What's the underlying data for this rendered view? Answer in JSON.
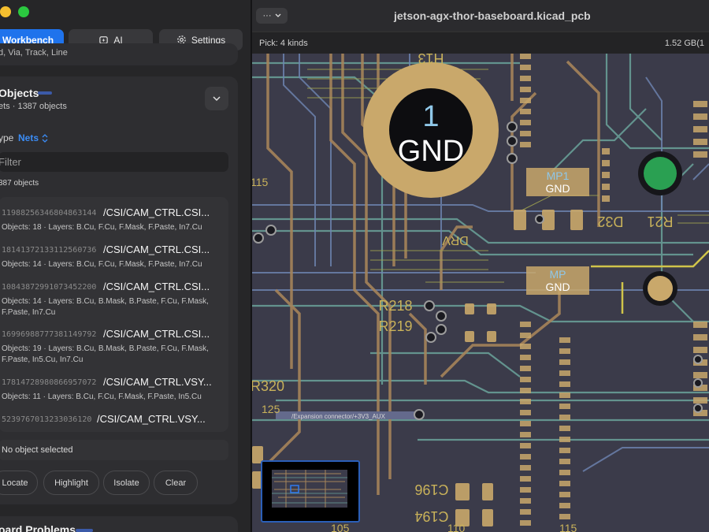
{
  "sidebar": {
    "tabs": {
      "workbench": "Workbench",
      "ai": "AI",
      "settings": "Settings"
    },
    "top_card_text": "d, Via, Track, Line",
    "objects": {
      "title": "Objects",
      "subtitle": "ets · 1387 objects",
      "type_label": "ype",
      "type_value": "Nets",
      "filter_placeholder": "Filter",
      "count_label": "387 objects",
      "items": [
        {
          "id": "11988256346804863144",
          "name": "/CSI/CAM_CTRL.CSI...",
          "meta": "Objects: 18 · Layers: B.Cu, F.Cu, F.Mask, F.Paste, In7.Cu"
        },
        {
          "id": "18141372133112560736",
          "name": "/CSI/CAM_CTRL.CSI...",
          "meta": "Objects: 14 · Layers: B.Cu, F.Cu, F.Mask, F.Paste, In7.Cu"
        },
        {
          "id": "10843872991073452200",
          "name": "/CSI/CAM_CTRL.CSI...",
          "meta": "Objects: 14 · Layers: B.Cu, B.Mask, B.Paste, F.Cu, F.Mask, F.Paste, In7.Cu"
        },
        {
          "id": "16996988777381149792",
          "name": "/CSI/CAM_CTRL.CSI...",
          "meta": "Objects: 19 · Layers: B.Cu, B.Mask, B.Paste, F.Cu, F.Mask, F.Paste, In5.Cu, In7.Cu"
        },
        {
          "id": "17814728980866957072",
          "name": "/CSI/CAM_CTRL.VSY...",
          "meta": "Objects: 11 · Layers: B.Cu, F.Cu, F.Mask, F.Paste, In5.Cu"
        },
        {
          "id": "5239767013233036120",
          "name": "/CSI/CAM_CTRL.VSY...",
          "meta": ""
        }
      ],
      "no_selection": "No object selected",
      "actions": {
        "locate": "Locate",
        "highlight": "Highlight",
        "isolate": "Isolate",
        "clear": "Clear"
      }
    },
    "problems_title": "oard Problems"
  },
  "editor": {
    "menu_label": "···",
    "doc_title": "jetson-agx-thor-baseboard.kicad_pcb",
    "pick_label": "Pick: 4 kinds",
    "memory": "1.52 GB(1"
  },
  "board": {
    "labels": {
      "h13": "H13",
      "pad_number": "1",
      "gnd": "GND",
      "mp1": "MP1",
      "mp": "MP",
      "d32": "D32",
      "r21": "R21",
      "drv": "DRV",
      "r218": "R218",
      "r219": "R219",
      "r320": "R320",
      "c196": "C196",
      "c194": "C194",
      "n115": "115",
      "n110": "110",
      "n105": "105",
      "n125": "125",
      "net_aux": "/Expansion connector/+3V3_AUX"
    },
    "colors": {
      "board_bg": "#3b3b4a",
      "copper_pad": "#c9a86b",
      "trace_brown": "#a6845a",
      "trace_teal": "#6aa39a",
      "trace_blue": "#6f86b3",
      "trace_yellow": "#d0c44a",
      "via_green": "#2aa052"
    }
  }
}
